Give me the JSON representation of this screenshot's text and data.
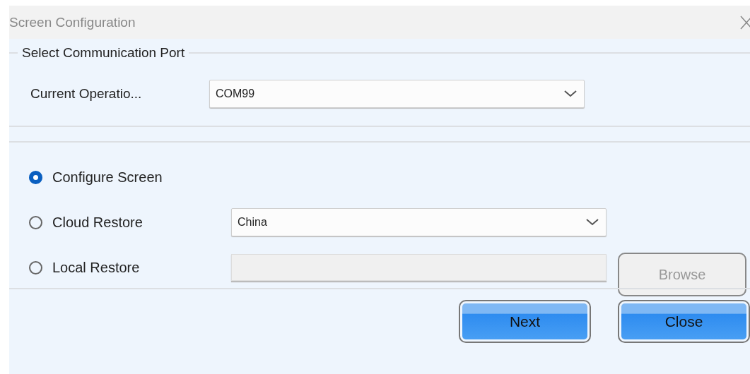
{
  "window": {
    "title": "Screen Configuration"
  },
  "port_group": {
    "title": "Select Communication Port",
    "label": "Current Operatio...",
    "value": "COM99"
  },
  "options": [
    {
      "label": "Configure Screen",
      "selected": true,
      "kind": "plain"
    },
    {
      "label": "Cloud Restore",
      "selected": false,
      "kind": "combo",
      "value": "China"
    },
    {
      "label": "Local Restore",
      "selected": false,
      "kind": "file",
      "disabled": true,
      "button": "Browse"
    }
  ],
  "buttons": [
    "Next",
    "Close"
  ]
}
